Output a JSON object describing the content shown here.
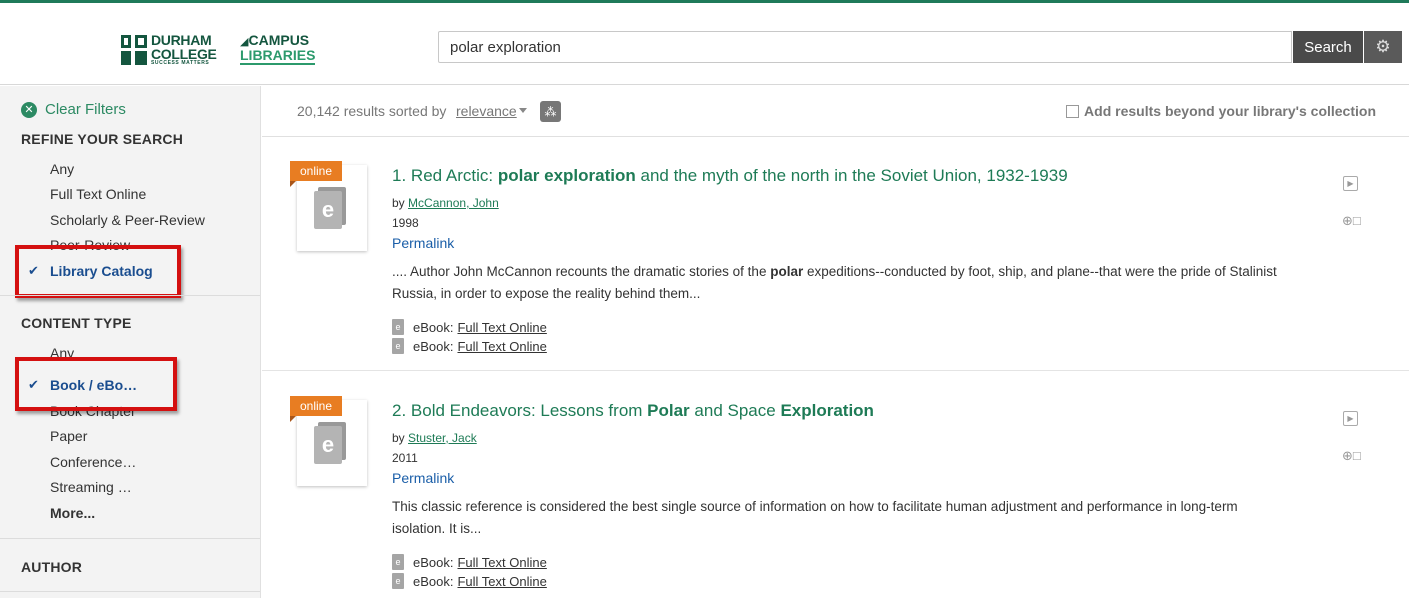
{
  "header": {
    "logo_durham_line1": "DURHAM",
    "logo_durham_line2": "COLLEGE",
    "logo_durham_tagline": "SUCCESS MATTERS",
    "logo_campus_line1": "CAMPUS",
    "logo_campus_line2": "LIBRARIES",
    "search_value": "polar exploration",
    "search_button": "Search",
    "gear_icon": "gear-icon"
  },
  "sidebar": {
    "clear_filters": "Clear Filters",
    "refine_title": "REFINE YOUR SEARCH",
    "refine_items": [
      "Any",
      "Full Text Online",
      "Scholarly & Peer-Review",
      "Peer-Review",
      "Library Catalog"
    ],
    "content_type_title": "CONTENT TYPE",
    "content_items": [
      "Any",
      "Book / eBo…",
      "Book Chapter",
      "Paper",
      "Conference…",
      "Streaming …",
      "More..."
    ],
    "author_title": "AUTHOR"
  },
  "results_bar": {
    "count_text": "20,142 results sorted by",
    "sort_value": "relevance",
    "beyond_label": "Add results beyond your library's collection"
  },
  "results": [
    {
      "number": "1.",
      "title_parts": [
        "Red Arctic: ",
        "polar exploration",
        " and the myth of the north in the Soviet Union, 1932-1939"
      ],
      "by": "by",
      "author": "McCannon, John",
      "year": "1998",
      "permalink": "Permalink",
      "badge": "online",
      "snippet_parts": [
        ".... Author John McCannon recounts the dramatic stories of the ",
        "polar",
        " expeditions--conducted by foot, ship, and plane--that were the pride of Stalinist Russia, in order to expose the reality behind them..."
      ],
      "links": [
        {
          "type": "eBook:",
          "text": "Full Text Online"
        },
        {
          "type": "eBook:",
          "text": "Full Text Online"
        }
      ]
    },
    {
      "number": "2.",
      "title_parts": [
        "Bold Endeavors: Lessons from ",
        "Polar",
        " and Space ",
        "Exploration"
      ],
      "by": "by",
      "author": "Stuster, Jack",
      "year": "2011",
      "permalink": "Permalink",
      "badge": "online",
      "snippet_parts": [
        "This classic reference is considered the best single source of information on how to facilitate human adjustment and performance in long-term isolation. It is..."
      ],
      "links": [
        {
          "type": "eBook:",
          "text": "Full Text Online"
        },
        {
          "type": "eBook:",
          "text": "Full Text Online"
        }
      ]
    }
  ],
  "colors": {
    "accent_green": "#1e7b56",
    "selected_blue": "#1a4d8f",
    "annotation_red": "#d41010",
    "badge_orange": "#e87d22"
  }
}
